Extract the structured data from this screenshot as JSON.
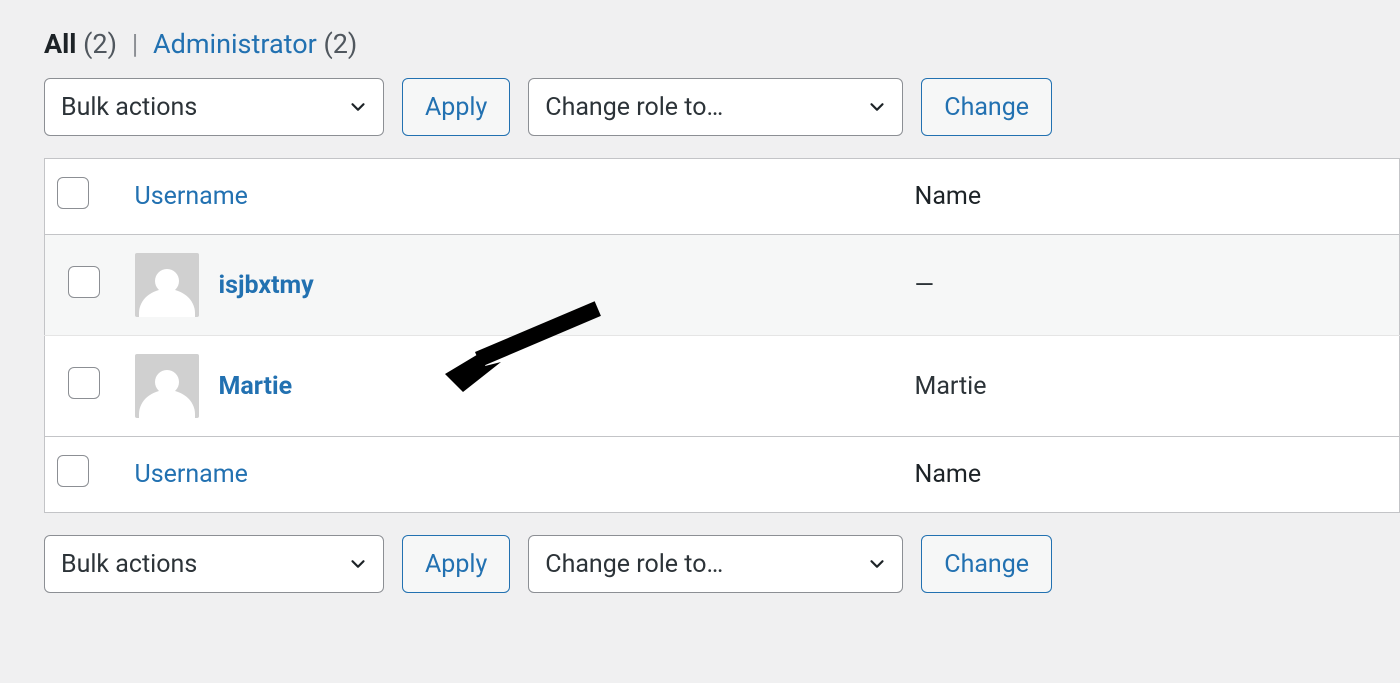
{
  "filters": {
    "all_label": "All",
    "all_count": "(2)",
    "admin_label": "Administrator",
    "admin_count": "(2)"
  },
  "controls": {
    "bulk_label": "Bulk actions",
    "apply_label": "Apply",
    "role_label": "Change role to…",
    "change_label": "Change"
  },
  "columns": {
    "username": "Username",
    "name": "Name"
  },
  "rows": [
    {
      "username": "isjbxtmy",
      "name": "—"
    },
    {
      "username": "Martie",
      "name": "Martie"
    }
  ]
}
